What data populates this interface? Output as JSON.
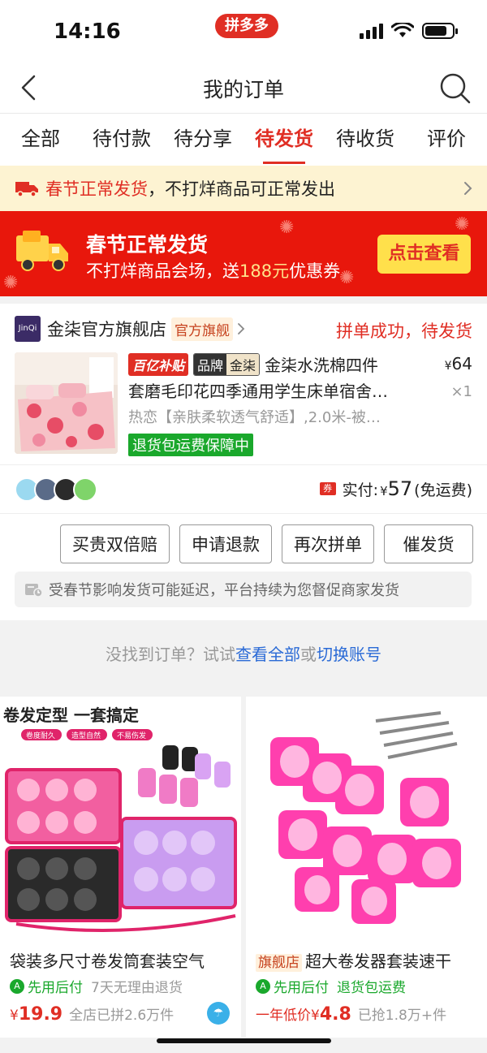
{
  "status_bar": {
    "time": "14:16",
    "app_badge": "拼多多"
  },
  "nav": {
    "title": "我的订单"
  },
  "tabs": [
    {
      "label": "全部",
      "active": false
    },
    {
      "label": "待付款",
      "active": false
    },
    {
      "label": "待分享",
      "active": false
    },
    {
      "label": "待发货",
      "active": true
    },
    {
      "label": "待收货",
      "active": false
    },
    {
      "label": "评价",
      "active": false
    }
  ],
  "notice": {
    "highlight": "春节正常发货",
    "text": "，不打烊商品可正常发出"
  },
  "banner": {
    "title": "春节正常发货",
    "sub_prefix": "不打烊商品会场，送",
    "sub_amount": "188元",
    "sub_suffix": "优惠券",
    "button": "点击查看"
  },
  "order": {
    "shop_logo_text": "JinQi",
    "shop_name": "金柒官方旗舰店",
    "shop_badge": "官方旗舰",
    "status": "拼单成功，待发货",
    "tag_subsidy": "百亿补贴",
    "tag_brand_a": "品牌",
    "tag_brand_b": "金柒",
    "title_line1": "金柒水洗棉四件",
    "title_line2": "套磨毛印花四季通用学生床单宿舍…",
    "spec": "热恋【亲肤柔软透气舒适】,2.0米-被…",
    "guarantee": "退货包运费保障中",
    "price_currency": "¥",
    "price": "64",
    "qty": "×1",
    "coupon_icon": "券",
    "paid_label": "实付:",
    "paid_currency": "¥",
    "paid_amount": "57",
    "shipping": "(免运费)",
    "buttons": [
      "买贵双倍赔",
      "申请退款",
      "再次拼单",
      "催发货"
    ],
    "delay_note": "受春节影响发货可能延迟，平台持续为您督促商家发货"
  },
  "not_found": {
    "prefix": "没找到订单？试试",
    "link_all": "查看全部",
    "mid": "或",
    "link_switch": "切换账号"
  },
  "recommendations": [
    {
      "banner_text": "卷发定型 一套搞定",
      "chips": [
        "卷度耐久",
        "造型自然",
        "不易伤发"
      ],
      "flag": "",
      "title": "袋装多尺寸卷发筒套装空气",
      "credit_badge": "A",
      "credit": "先用后付",
      "extra": "7天无理由退货",
      "price_prefix": "",
      "currency": "¥",
      "price": "19.9",
      "sales": "全店已拼2.6万件"
    },
    {
      "banner_text": "",
      "chips": [],
      "flag": "旗舰店",
      "title": "超大卷发器套装速干",
      "credit_badge": "A",
      "credit": "先用后付",
      "extra": "退货包运费",
      "price_prefix": "一年低价",
      "currency": "¥",
      "price": "4.8",
      "sales": "已抢1.8万+件"
    }
  ],
  "colors": {
    "brand_red": "#e02e24",
    "guarantee_green": "#1aa82c",
    "link_blue": "#2a6ad6",
    "banner_yellow": "#ffe04b"
  }
}
